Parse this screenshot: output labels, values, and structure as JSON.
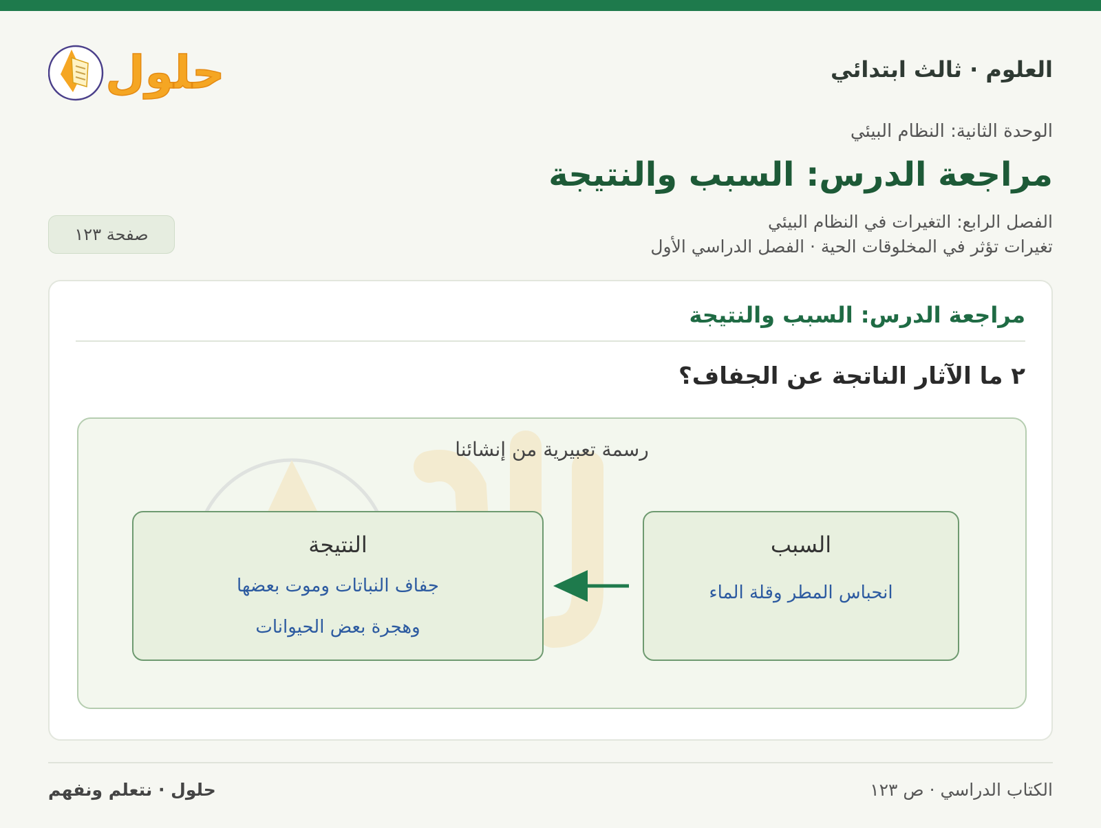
{
  "header": {
    "subject": "العلوم · ثالث ابتدائي",
    "logo_text": "حلول"
  },
  "meta": {
    "unit": "الوحدة الثانية: النظام البيئي",
    "lesson_title": "مراجعة الدرس: السبب والنتيجة",
    "chapter": "الفصل الرابع: التغيرات في النظام البيئي",
    "topic": "تغيرات تؤثر في المخلوقات الحية · الفصل الدراسي الأول",
    "page_badge": "صفحة ١٢٣"
  },
  "card": {
    "title": "مراجعة الدرس: السبب والنتيجة",
    "question": "٢ ما الآثار الناتجة عن الجفاف؟",
    "figure": {
      "caption": "رسمة تعبيرية من إنشائنا",
      "cause": {
        "heading": "السبب",
        "text": "انحباس المطر وقلة الماء"
      },
      "effect": {
        "heading": "النتيجة",
        "line1": "جفاف النباتات وموت بعضها",
        "line2": "وهجرة بعض الحيوانات"
      }
    }
  },
  "footer": {
    "right": "الكتاب الدراسي · ص ١٢٣",
    "left": "حلول · نتعلم ونفهم"
  },
  "colors": {
    "brand_green": "#1e7a4c",
    "logo_orange": "#f5a623",
    "link_blue": "#2c5aa0"
  }
}
